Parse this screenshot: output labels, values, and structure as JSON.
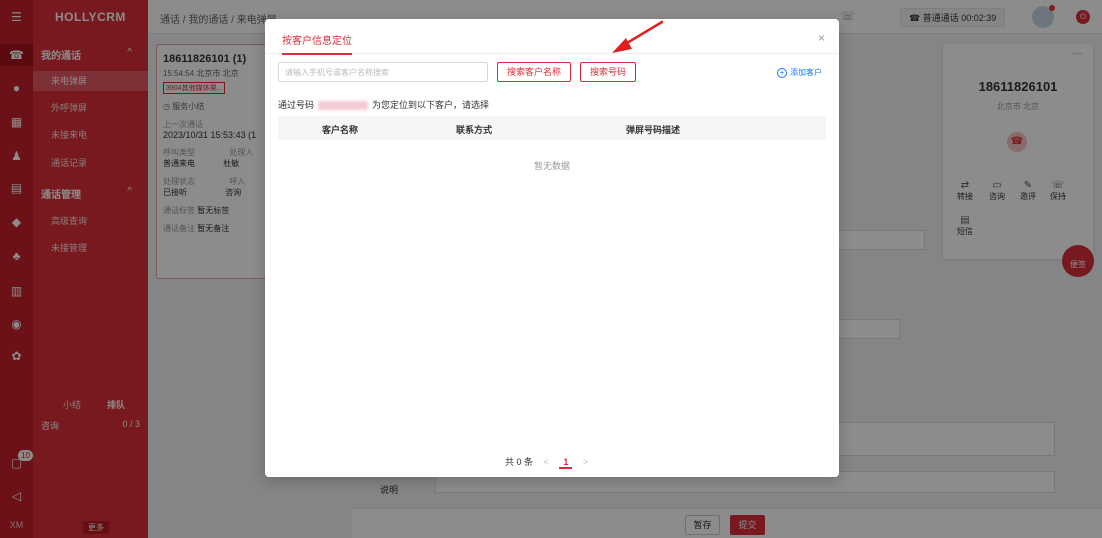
{
  "app": {
    "brand": "HOLLYCRM"
  },
  "breadcrumb": {
    "text": "通话 / 我的通话 / 来电弹屏"
  },
  "topbar": {
    "call_status": "普通通话 00:02:39",
    "status_icon": "phone-icon"
  },
  "rail": {
    "icons": [
      "menu-icon",
      "phone-icon",
      "chat-icon",
      "grid-icon",
      "user-icon",
      "document-icon",
      "shield-icon",
      "robot-icon",
      "chart-icon",
      "share-icon",
      "gear-icon"
    ],
    "badge": "10",
    "footer": "XM"
  },
  "sidebar": {
    "group1": "我的通话",
    "items1": [
      "来电弹屏",
      "外呼弹屏",
      "未接来电",
      "通话记录"
    ],
    "group2": "通话管理",
    "items2": [
      "高级查询",
      "未接管理"
    ],
    "queue_tabs": [
      "小结",
      "排队"
    ],
    "queue_row": {
      "label": "咨询",
      "count": "0 / 3"
    },
    "more": "更多"
  },
  "call_card": {
    "number": "18611826101 (1)",
    "time_loc": "15:54:54 北京市 北京",
    "tag": "3904其他媒体渠...",
    "summary": "服务小结",
    "last_call_label": "上一次通话",
    "last_call_time": "2023/10/31 15:53:43 (1",
    "call_type_label": "呼叫类型",
    "call_type": "普通来电",
    "handler_label": "处理人",
    "handler": "杜敏",
    "state_label": "处理状态",
    "state": "已接听",
    "enter_label": "呼入",
    "enter_val": "咨询",
    "tag_label": "通话标签",
    "tag_val": "暂无标签",
    "note_label": "通话备注",
    "note_val": "暂无备注"
  },
  "phone_panel": {
    "number": "18611826101",
    "location": "北京市 北京",
    "actions": [
      "转接",
      "咨询",
      "邀评",
      "保持",
      "短信"
    ],
    "float_button": "便签"
  },
  "form": {
    "desc_label": "说明",
    "save": "暂存",
    "submit": "提交"
  },
  "modal": {
    "tab": "按客户信息定位",
    "search_placeholder": "请输入手机号或客户名称搜索",
    "search_by_name": "搜索客户名称",
    "search_by_number": "搜索号码",
    "add_customer": "添加客户",
    "info_prefix": "通过号码",
    "info_suffix": "为您定位到以下客户，请选择",
    "columns": [
      "客户名称",
      "联系方式",
      "弹屏号码描述"
    ],
    "empty_text": "暂无数据",
    "pagination": {
      "total": "共 0 条",
      "current": "1"
    }
  },
  "colors": {
    "primary": "#d92e39",
    "rail": "#c3202b",
    "link": "#1677ff"
  }
}
